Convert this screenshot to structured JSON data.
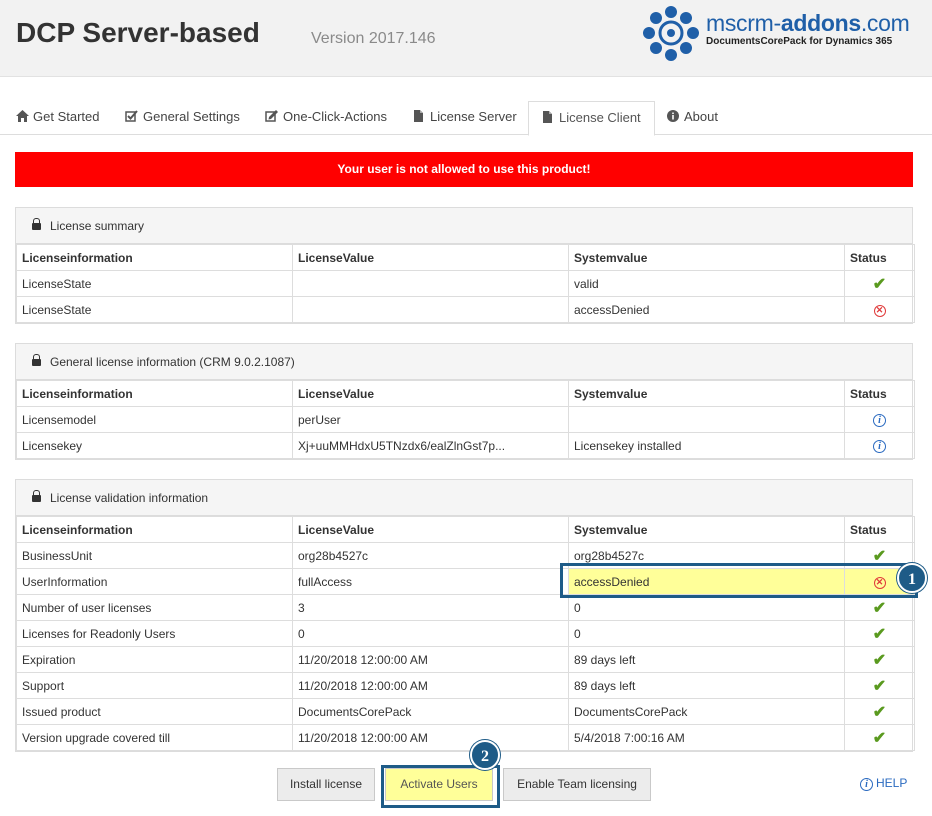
{
  "header": {
    "title": "DCP Server-based",
    "version": "Version 2017.146",
    "logo_text_a": "mscrm-",
    "logo_text_b": "addons",
    "logo_text_c": ".com",
    "logo_sub": "DocumentsCorePack for Dynamics 365"
  },
  "tabs": [
    {
      "label": "Get Started",
      "icon": "home-icon"
    },
    {
      "label": "General Settings",
      "icon": "checkbox-icon"
    },
    {
      "label": "One-Click-Actions",
      "icon": "edit-check-icon"
    },
    {
      "label": "License Server",
      "icon": "document-icon"
    },
    {
      "label": "License Client",
      "icon": "document-icon"
    },
    {
      "label": "About",
      "icon": "info-circle-icon"
    }
  ],
  "alert": "Your user is not allowed to use this product!",
  "columns": [
    "Licenseinformation",
    "LicenseValue",
    "Systemvalue",
    "Status"
  ],
  "summary": {
    "title": "License summary",
    "rows": [
      {
        "info": "LicenseState",
        "value": "",
        "system": "valid",
        "status": "ok"
      },
      {
        "info": "LicenseState",
        "value": "",
        "system": "accessDenied",
        "status": "error"
      }
    ]
  },
  "general": {
    "title": "General license information (CRM 9.0.2.1087)",
    "rows": [
      {
        "info": "Licensemodel",
        "value": "perUser",
        "system": "",
        "status": "info"
      },
      {
        "info": "Licensekey",
        "value": "Xj+uuMMHdxU5TNzdx6/ealZlnGst7p...",
        "system": "Licensekey installed",
        "status": "info"
      }
    ]
  },
  "validation": {
    "title": "License validation information",
    "rows": [
      {
        "info": "BusinessUnit",
        "value": "org28b4527c",
        "system": "org28b4527c",
        "status": "ok"
      },
      {
        "info": "UserInformation",
        "value": "fullAccess",
        "system": "accessDenied",
        "status": "error"
      },
      {
        "info": "Number of user licenses",
        "value": "3",
        "system": "0",
        "status": "ok"
      },
      {
        "info": "Licenses for Readonly Users",
        "value": "0",
        "system": "0",
        "status": "ok"
      },
      {
        "info": "Expiration",
        "value": "11/20/2018 12:00:00 AM",
        "system": "89 days left",
        "status": "ok"
      },
      {
        "info": "Support",
        "value": "11/20/2018 12:00:00 AM",
        "system": "89 days left",
        "status": "ok"
      },
      {
        "info": "Issued product",
        "value": "DocumentsCorePack",
        "system": "DocumentsCorePack",
        "status": "ok"
      },
      {
        "info": "Version upgrade covered till",
        "value": "11/20/2018 12:00:00 AM",
        "system": "5/4/2018 7:00:16 AM",
        "status": "ok"
      }
    ]
  },
  "callouts": {
    "one": "1",
    "two": "2"
  },
  "buttons": {
    "install": "Install license",
    "activate": "Activate Users",
    "team": "Enable Team licensing",
    "help": "HELP"
  },
  "colors": {
    "alert": "#ff0000",
    "highlight": "#ffff99",
    "callout": "#1e5b87",
    "ok": "#5a9a1f",
    "error": "#e03a3a"
  }
}
